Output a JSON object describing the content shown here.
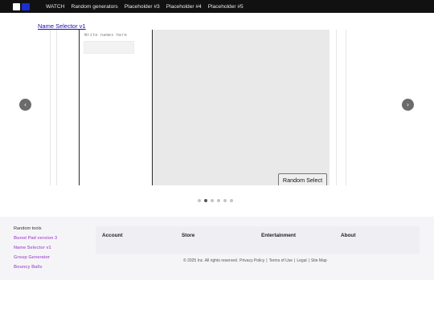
{
  "nav": {
    "links": [
      "WATCH",
      "Random generators",
      "Placeholder #3",
      "Placeholder #4",
      "Placeholder #5"
    ]
  },
  "carousel": {
    "page_link": "Name Selector v1",
    "names_label": "Write names here",
    "random_button": "Random Select",
    "prev_arrow": "‹",
    "next_arrow": "›",
    "slide_count": 6,
    "active_slide": 2
  },
  "footer": {
    "tools_heading": "Random tools",
    "tools": [
      "Bunot Pad version 3",
      "Name Selector v1",
      "Group Generator",
      "Bouncy Balls"
    ],
    "columns": [
      "Account",
      "Store",
      "Entertainment",
      "About"
    ],
    "copyright": "© 2025 Inc. All rights reserved.",
    "legal_links": [
      "Privacy Policy",
      "Terms of Use",
      "Legal",
      "Site Map"
    ],
    "separator": "|"
  },
  "colors": {
    "nav_bg": "#111111",
    "brand_blue": "#1a2fd0",
    "tool_link": "#b06ad6",
    "page_link": "#1a0dab"
  }
}
